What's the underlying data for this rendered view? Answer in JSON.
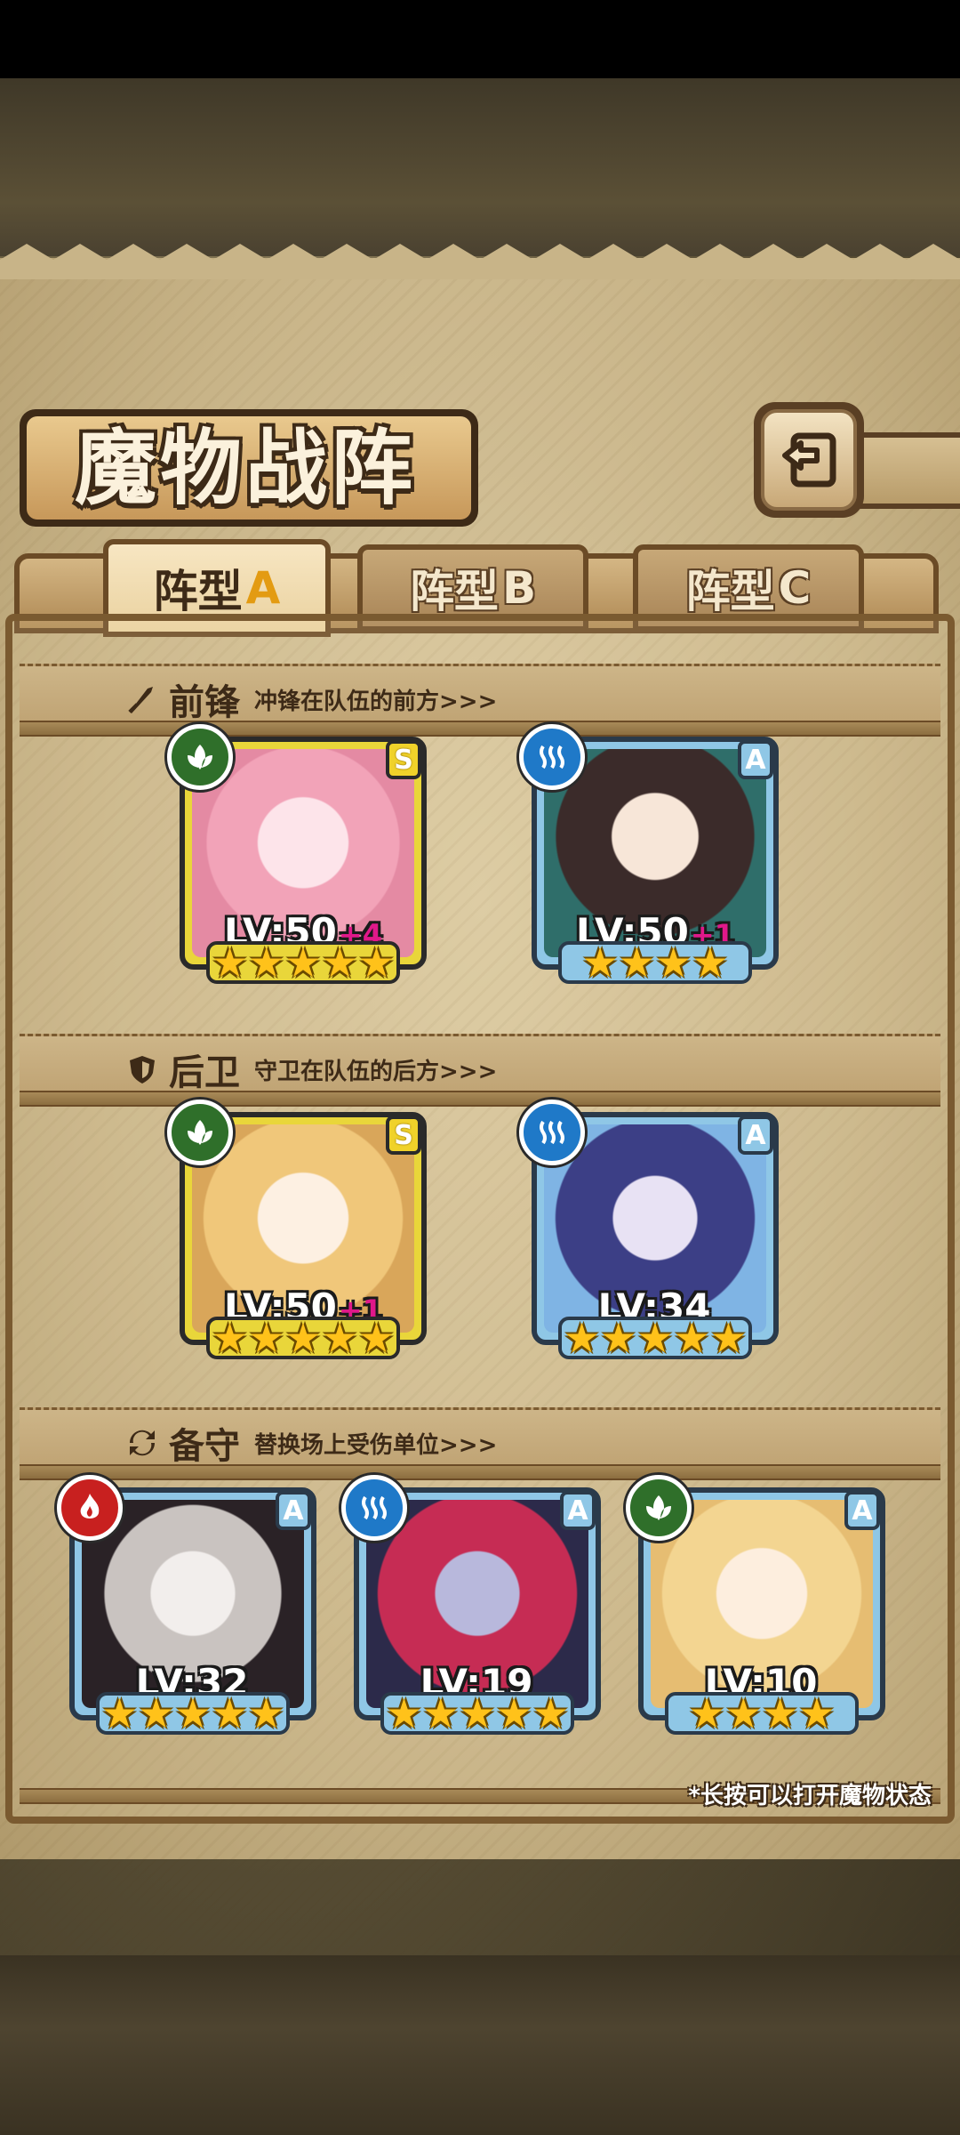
{
  "header": {
    "title": "魔物战阵"
  },
  "tabs": [
    {
      "label": "阵型",
      "letter": "A",
      "active": true
    },
    {
      "label": "阵型",
      "letter": "B",
      "active": false
    },
    {
      "label": "阵型",
      "letter": "C",
      "active": false
    }
  ],
  "sections": {
    "front": {
      "name": "前锋",
      "desc": "冲锋在队伍的前方>>>",
      "icon": "sword-icon"
    },
    "back": {
      "name": "后卫",
      "desc": "守卫在队伍的后方>>>",
      "icon": "shield-icon"
    },
    "reserve": {
      "name": "备守",
      "desc": "替换场上受伤单位>>>",
      "icon": "swap-icon"
    }
  },
  "cards": {
    "front_1": {
      "rank": "S",
      "element": "nature-icon",
      "level": "LV:50",
      "bonus": "+4",
      "stars": 5
    },
    "front_2": {
      "rank": "A",
      "element": "water-icon",
      "level": "LV:50",
      "bonus": "+1",
      "stars": 4
    },
    "back_1": {
      "rank": "S",
      "element": "nature-icon",
      "level": "LV:50",
      "bonus": "+1",
      "stars": 5
    },
    "back_2": {
      "rank": "A",
      "element": "water-icon",
      "level": "LV:34",
      "bonus": "",
      "stars": 5
    },
    "reserve_1": {
      "rank": "A",
      "element": "fire-icon",
      "level": "LV:32",
      "bonus": "",
      "stars": 5
    },
    "reserve_2": {
      "rank": "A",
      "element": "water-icon",
      "level": "LV:19",
      "bonus": "",
      "stars": 5
    },
    "reserve_3": {
      "rank": "A",
      "element": "nature-icon",
      "level": "LV:10",
      "bonus": "",
      "stars": 4
    }
  },
  "hint": "*长按可以打开魔物状态",
  "colors": {
    "rank_S": "#e9d63a",
    "rank_A": "#8fc7e6",
    "nature": "#2f6f2a",
    "water": "#1f79c8",
    "fire": "#c8201f",
    "star": "#ffc21a",
    "bonus": "#e0188a"
  }
}
